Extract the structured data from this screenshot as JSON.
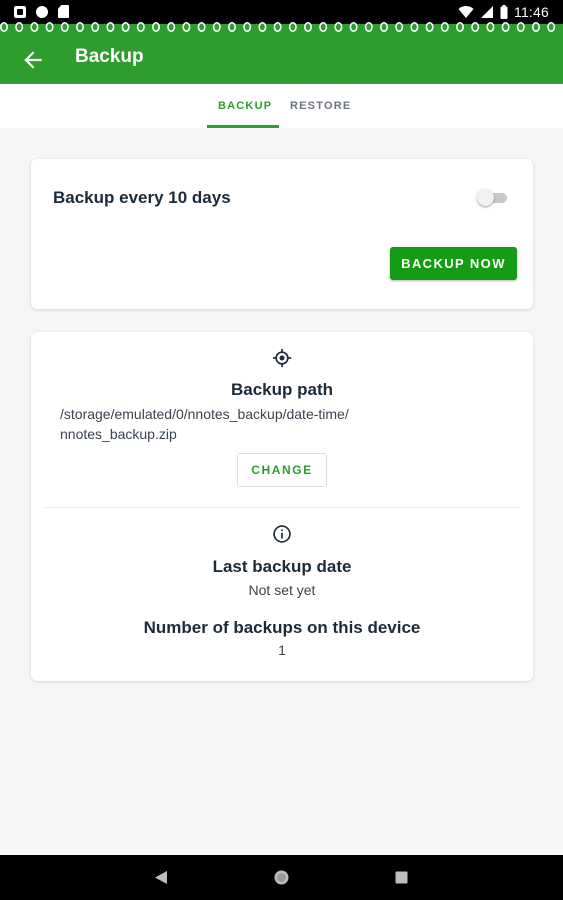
{
  "status_bar": {
    "time": "11:46"
  },
  "toolbar": {
    "title": "Backup",
    "back_icon": "arrow-left-icon",
    "color": "#2e9c2e"
  },
  "tabs": [
    {
      "label": "BACKUP",
      "selected": true
    },
    {
      "label": "RESTORE",
      "selected": false
    }
  ],
  "schedule_card": {
    "label": "Backup every 10 days",
    "toggle_on": false,
    "button_label": "BACKUP NOW",
    "button_color": "#149d14"
  },
  "info_card": {
    "path_icon": "target-icon",
    "path_heading": "Backup path",
    "path_value": "/storage/emulated/0/nnotes_backup/date-time/ nnotes_backup.zip",
    "change_label": "CHANGE",
    "info_icon": "info-icon",
    "last_heading": "Last backup date",
    "last_value": "Not set yet",
    "count_heading": "Number of backups on this device",
    "count_value": "1"
  },
  "nav_bar": {
    "back_icon": "triangle-back-icon",
    "home_icon": "circle-home-icon",
    "recents_icon": "square-recents-icon"
  }
}
